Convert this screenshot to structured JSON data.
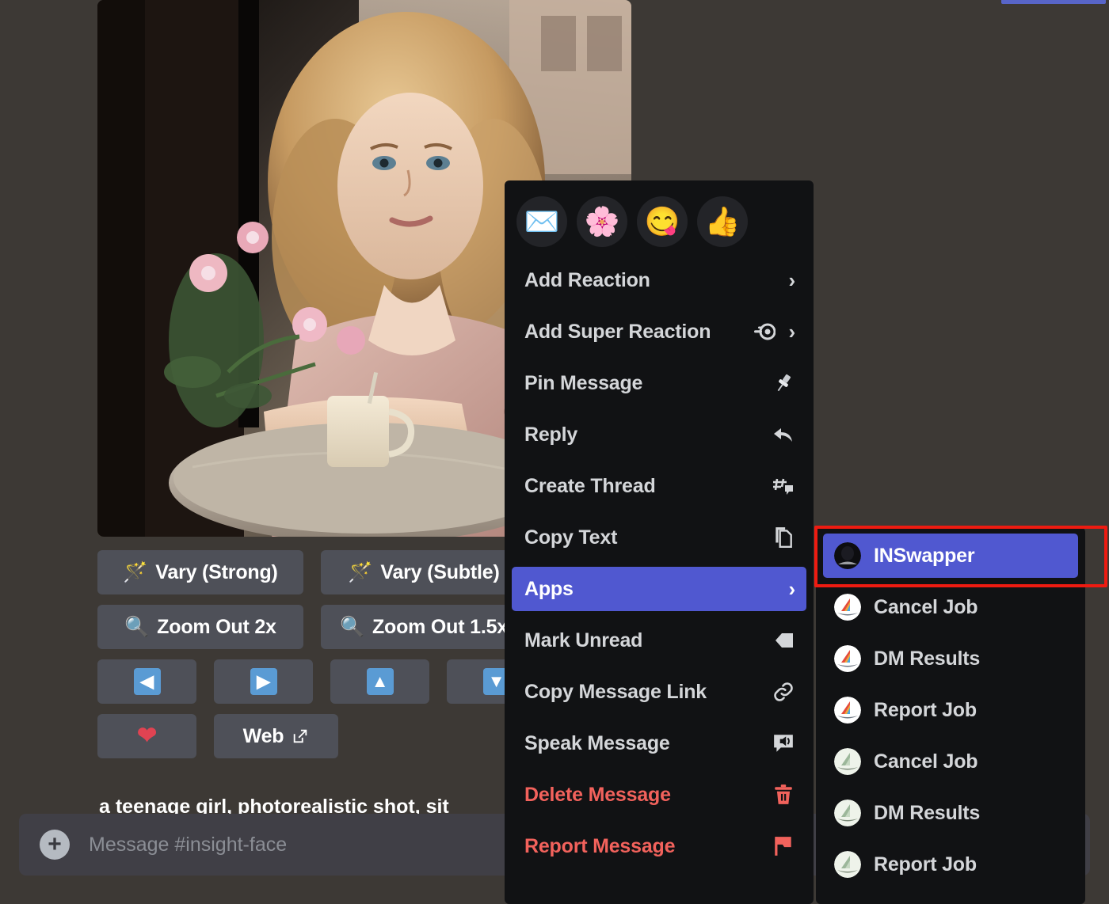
{
  "app": {
    "background_color": "#3d3935",
    "menu_background_color": "#111214",
    "accent_blurple": "#5058d0",
    "danger_color": "#f2625c",
    "highlight_border_color": "#ee1b11"
  },
  "message": {
    "prompt_text_partial": "a teenage girl, photorealistic shot, sit",
    "image_alt": "photorealistic teenage girl sitting at a cafe table with flowers and a glass mug"
  },
  "midjourney_buttons": {
    "row1": [
      {
        "icon": "magic-wand-icon",
        "glyph": "🪄",
        "label": "Vary (Strong)"
      },
      {
        "icon": "magic-wand-icon",
        "glyph": "🪄",
        "label": "Vary (Subtle)"
      }
    ],
    "row2": [
      {
        "icon": "magnifier-icon",
        "glyph": "🔍",
        "label": "Zoom Out 2x"
      },
      {
        "icon": "magnifier-icon",
        "glyph": "🔍",
        "label": "Zoom Out 1.5x"
      }
    ],
    "row3": [
      {
        "icon": "arrow-left-icon",
        "glyph": "⬅",
        "label": ""
      },
      {
        "icon": "arrow-right-icon",
        "glyph": "➡",
        "label": ""
      },
      {
        "icon": "arrow-up-icon",
        "glyph": "⬆",
        "label": ""
      },
      {
        "icon": "arrow-down-icon",
        "glyph": "⬇",
        "label": ""
      }
    ],
    "row4": [
      {
        "icon": "heart-icon",
        "glyph": "❤",
        "label": ""
      },
      {
        "icon": "external-link-icon",
        "glyph": "",
        "label": "Web"
      }
    ]
  },
  "composer": {
    "add_icon": "plus-icon",
    "placeholder": "Message #insight-face",
    "value": ""
  },
  "context_menu": {
    "quick_reactions": [
      {
        "name": "envelope-emoji",
        "glyph": "✉️"
      },
      {
        "name": "cherry-blossom-emoji",
        "glyph": "🌸"
      },
      {
        "name": "yum-face-emoji",
        "glyph": "😋"
      },
      {
        "name": "thumbs-up-emoji",
        "glyph": "👍"
      }
    ],
    "items": [
      {
        "id": "add-reaction",
        "label": "Add Reaction",
        "icon": "chevron-right-icon",
        "submenu": true,
        "selected": false,
        "danger": false
      },
      {
        "id": "add-super-reaction",
        "label": "Add Super Reaction",
        "icon": "super-reaction-icon",
        "submenu": true,
        "selected": false,
        "danger": false
      },
      {
        "id": "pin-message",
        "label": "Pin Message",
        "icon": "pin-icon",
        "submenu": false,
        "selected": false,
        "danger": false
      },
      {
        "id": "reply",
        "label": "Reply",
        "icon": "reply-arrow-icon",
        "submenu": false,
        "selected": false,
        "danger": false
      },
      {
        "id": "create-thread",
        "label": "Create Thread",
        "icon": "thread-icon",
        "submenu": false,
        "selected": false,
        "danger": false
      },
      {
        "id": "copy-text",
        "label": "Copy Text",
        "icon": "copy-icon",
        "submenu": false,
        "selected": false,
        "danger": false
      },
      {
        "id": "apps",
        "label": "Apps",
        "icon": "chevron-right-icon",
        "submenu": true,
        "selected": true,
        "danger": false
      },
      {
        "id": "mark-unread",
        "label": "Mark Unread",
        "icon": "mark-unread-icon",
        "submenu": false,
        "selected": false,
        "danger": false
      },
      {
        "id": "copy-message-link",
        "label": "Copy Message Link",
        "icon": "link-icon",
        "submenu": false,
        "selected": false,
        "danger": false
      },
      {
        "id": "speak-message",
        "label": "Speak Message",
        "icon": "speaker-icon",
        "submenu": false,
        "selected": false,
        "danger": false
      },
      {
        "id": "delete-message",
        "label": "Delete Message",
        "icon": "trash-icon",
        "submenu": false,
        "selected": false,
        "danger": true
      },
      {
        "id": "report-message",
        "label": "Report Message",
        "icon": "flag-icon",
        "submenu": false,
        "selected": false,
        "danger": true
      }
    ]
  },
  "apps_submenu": {
    "items": [
      {
        "id": "inswapper",
        "label": "INSwapper",
        "avatar": "inswapper-dark-avatar",
        "selected": true
      },
      {
        "id": "cancel-job-1",
        "label": "Cancel Job",
        "avatar": "rainbow-sailboat-avatar",
        "selected": false
      },
      {
        "id": "dm-results-1",
        "label": "DM Results",
        "avatar": "rainbow-sailboat-avatar",
        "selected": false
      },
      {
        "id": "report-job-1",
        "label": "Report Job",
        "avatar": "rainbow-sailboat-avatar",
        "selected": false
      },
      {
        "id": "cancel-job-2",
        "label": "Cancel Job",
        "avatar": "green-sailboat-avatar",
        "selected": false
      },
      {
        "id": "dm-results-2",
        "label": "DM Results",
        "avatar": "green-sailboat-avatar",
        "selected": false
      },
      {
        "id": "report-job-2",
        "label": "Report Job",
        "avatar": "green-sailboat-avatar",
        "selected": false
      }
    ]
  }
}
